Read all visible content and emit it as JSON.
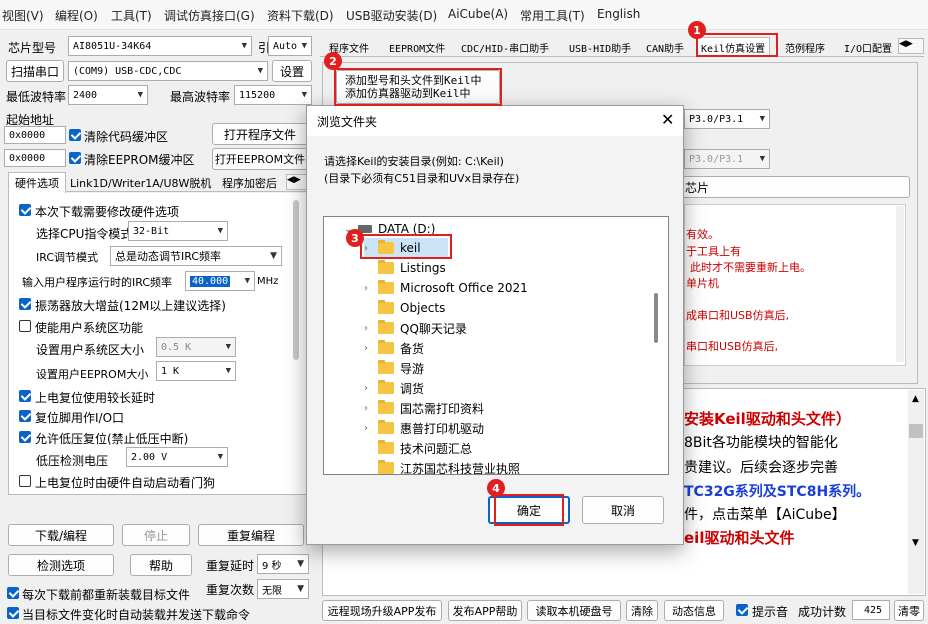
{
  "menu": [
    "视图(V)",
    "编程(O)",
    "工具(T)",
    "调试仿真接口(G)",
    "资料下载(D)",
    "USB驱动安装(D)",
    "AiCube(A)",
    "常用工具(T)",
    "English"
  ],
  "left": {
    "chip_model_label": "芯片型号",
    "chip_model": "AI8051U-34K64",
    "pin_label": "引脚数",
    "pin_value": "Auto",
    "scan_label": "扫描串口",
    "port_value": "(COM9) USB-CDC,CDC",
    "settings_label": "设置",
    "min_baud_label": "最低波特率",
    "min_baud": "2400",
    "max_baud_label": "最高波特率",
    "max_baud": "115200",
    "start_addr_label": "起始地址",
    "addr1": "0x0000",
    "clear_code_label": "清除代码缓冲区",
    "open_prog_label": "打开程序文件",
    "addr2": "0x0000",
    "clear_eeprom_label": "清除EEPROM缓冲区",
    "open_eeprom_label": "打开EEPROM文件",
    "subtabs": [
      "硬件选项",
      "Link1D/Writer1A/U8W脱机",
      "程序加密后"
    ],
    "opt_need_modify": "本次下载需要修改硬件选项",
    "cpu_instr_label": "选择CPU指令模式",
    "cpu_instr": "32-Bit",
    "irc_mode_label": "IRC调节模式",
    "irc_mode": "总是动态调节IRC频率",
    "irc_freq_label": "输入用户程序运行时的IRC频率",
    "irc_freq": "40.000",
    "irc_unit": "MHz",
    "osc_gain": "振荡器放大增益(12M以上建议选择)",
    "user_sys_area": "使能用户系统区功能",
    "sys_area_size_label": "设置用户系统区大小",
    "sys_area_size": "0.5 K",
    "eeprom_size_label": "设置用户EEPROM大小",
    "eeprom_size": "1   K",
    "power_reset_delay": "上电复位使用较长延时",
    "reset_pin_io": "复位脚用作I/O口",
    "allow_lvr": "允许低压复位(禁止低压中断)",
    "lvr_voltage_label": "低压检测电压",
    "lvr_voltage": "2.00 V",
    "watchdog": "上电复位时由硬件自动启动看门狗",
    "download_btn": "下载/编程",
    "stop_btn": "停止",
    "reprogram_btn": "重复编程",
    "detect_btn": "检测选项",
    "help_btn": "帮助",
    "repeat_delay_label": "重复延时",
    "repeat_delay": "9 秒",
    "repeat_count_label": "重复次数",
    "repeat_count": "无限",
    "reload_each": "每次下载前都重新装载目标文件",
    "auto_reload": "当目标文件变化时自动装载并发送下载命令"
  },
  "right": {
    "tabs": [
      "程序文件",
      "EEPROM文件",
      "CDC/HID-串口助手",
      "USB-HID助手",
      "CAN助手",
      "Keil仿真设置",
      "范例程序",
      "I/O口配置"
    ],
    "add_model_btn": "添加型号和头文件到Keil中",
    "add_driver_btn": "添加仿真器驱动到Keil中",
    "port_sel1": "P3.0/P3.1",
    "port_sel2": "P3.0/P3.1",
    "chip_btn_tail": "芯片",
    "notes": [
      "有效。",
      "于工具上有",
      "此时才不需要重新上电。",
      "单片机",
      "成串口和USB仿真后,",
      "串口和USB仿真后,"
    ],
    "rich_lines": [
      "安装Keil驱动和头文件）",
      "8Bit各功能模块的智能化",
      "贵建议。后续会逐步完善",
      "TC32G系列及STC8H系列。",
      "件，点击菜单【AiCube】",
      "eil驱动和头文件"
    ],
    "bottom": {
      "remote_upgrade": "远程现场升级APP发布",
      "publish_help": "发布APP帮助",
      "read_disk": "读取本机硬盘号",
      "clear": "清除",
      "dynamic_info": "动态信息",
      "beep": "提示音",
      "success_count_label": "成功计数",
      "success_count": "425",
      "clear_count": "清零"
    }
  },
  "dialog": {
    "title": "浏览文件夹",
    "desc1": "请选择Keil的安装目录(例如: C:\\Keil)",
    "desc2": "(目录下必须有C51目录和UVx目录存在)",
    "drive": "DATA (D:)",
    "folders": [
      "keil",
      "Listings",
      "Microsoft Office 2021",
      "Objects",
      "QQ聊天记录",
      "备货",
      "导游",
      "调货",
      "国芯需打印资料",
      "惠普打印机驱动",
      "技术问题汇总",
      "江苏国芯科技营业执照"
    ],
    "ok": "确定",
    "cancel": "取消"
  },
  "badges": [
    "1",
    "2",
    "3",
    "4"
  ],
  "colors": {
    "accent": "#0a64c8",
    "annotation": "#e02020",
    "folder": "#f6c544",
    "rich_red": "#cc0000",
    "rich_blue": "#1a3fd6"
  }
}
